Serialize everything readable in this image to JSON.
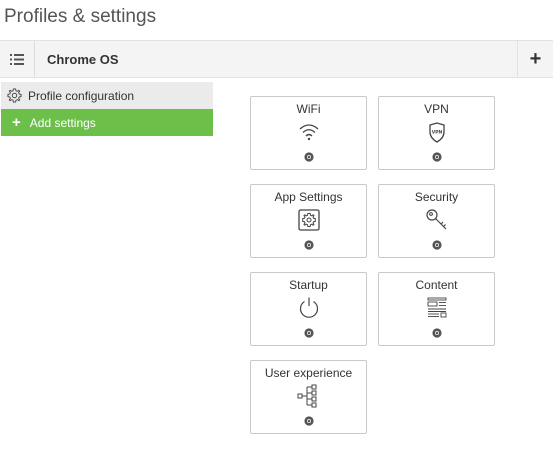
{
  "page": {
    "title": "Profiles & settings"
  },
  "os_bar": {
    "title": "Chrome OS",
    "add_label": "+"
  },
  "sidebar": {
    "items": [
      {
        "label": "Profile configuration",
        "icon": "gear-icon"
      },
      {
        "label": "Add settings",
        "icon": "plus-icon",
        "prefix": "+"
      }
    ]
  },
  "tiles": [
    {
      "label": "WiFi",
      "icon": "wifi-icon"
    },
    {
      "label": "VPN",
      "icon": "vpn-shield-icon",
      "icon_text": "VPN"
    },
    {
      "label": "App Settings",
      "icon": "app-settings-icon"
    },
    {
      "label": "Security",
      "icon": "key-icon"
    },
    {
      "label": "Startup",
      "icon": "power-icon"
    },
    {
      "label": "Content",
      "icon": "content-icon"
    },
    {
      "label": "User experience",
      "icon": "hierarchy-icon"
    }
  ],
  "colors": {
    "accent_green": "#6cc04a",
    "tile_border": "#c9c9c9",
    "bar_bg": "#f4f4f4"
  }
}
